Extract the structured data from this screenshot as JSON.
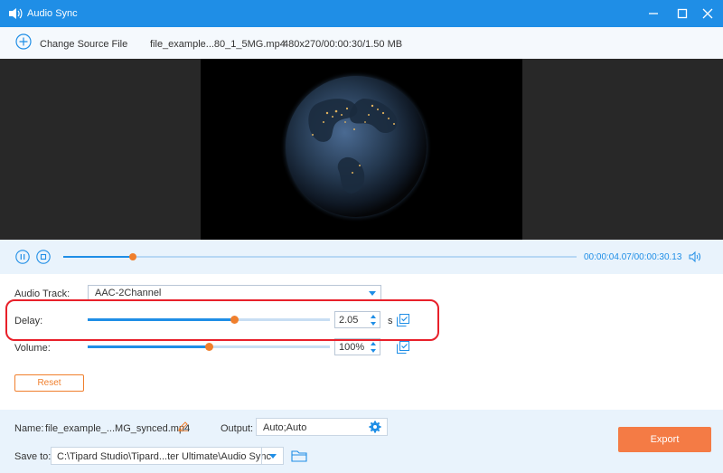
{
  "window": {
    "title": "Audio Sync"
  },
  "toolbar": {
    "change_source_label": "Change Source File",
    "file_name": "file_example...80_1_5MG.mp4",
    "file_info": "480x270/00:00:30/1.50 MB"
  },
  "player": {
    "current_time": "00:00:04.07",
    "total_time": "/00:00:30.13",
    "progress_percent": 13.5
  },
  "audio_track": {
    "label": "Audio Track:",
    "value": "AAC-2Channel"
  },
  "delay": {
    "label": "Delay:",
    "value": "2.05",
    "unit": "s",
    "slider_percent": 60.5
  },
  "volume": {
    "label": "Volume:",
    "value": "100%",
    "slider_percent": 50
  },
  "reset_label": "Reset",
  "bottom": {
    "name_label": "Name:",
    "name_value": "file_example_...MG_synced.mp4",
    "output_label": "Output:",
    "output_value": "Auto;Auto",
    "save_to_label": "Save to:",
    "save_to_value": "C:\\Tipard Studio\\Tipard...ter Ultimate\\Audio Sync",
    "export_label": "Export"
  },
  "colors": {
    "accent": "#1f8ee6",
    "orange": "#f07f2c",
    "highlight": "#e8202a"
  }
}
